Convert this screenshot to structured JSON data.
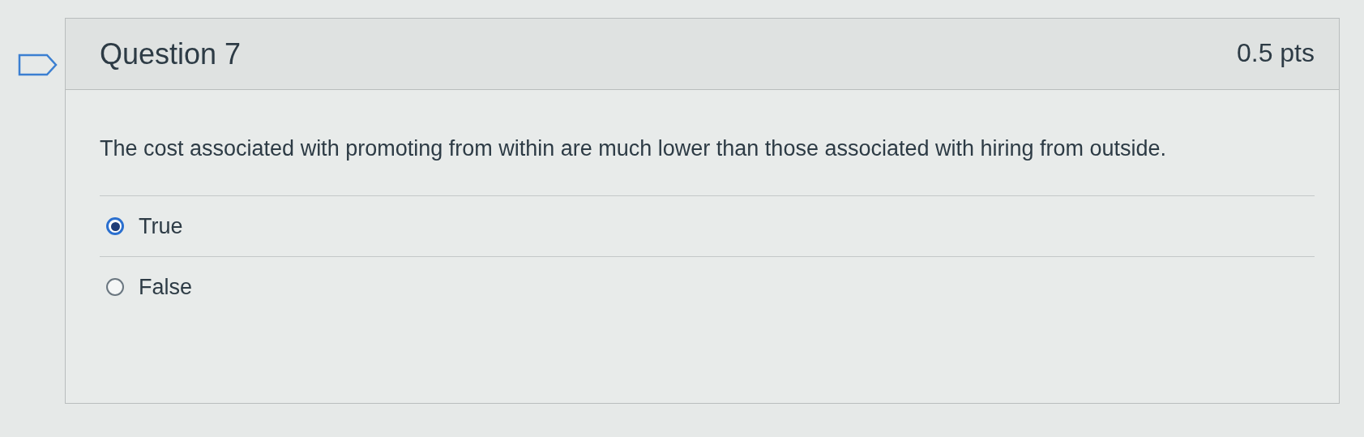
{
  "question": {
    "title": "Question 7",
    "points": "0.5 pts",
    "text": "The cost associated with promoting from within are much lower than those associated with hiring from outside.",
    "answers": [
      {
        "label": "True",
        "selected": true
      },
      {
        "label": "False",
        "selected": false
      }
    ]
  }
}
